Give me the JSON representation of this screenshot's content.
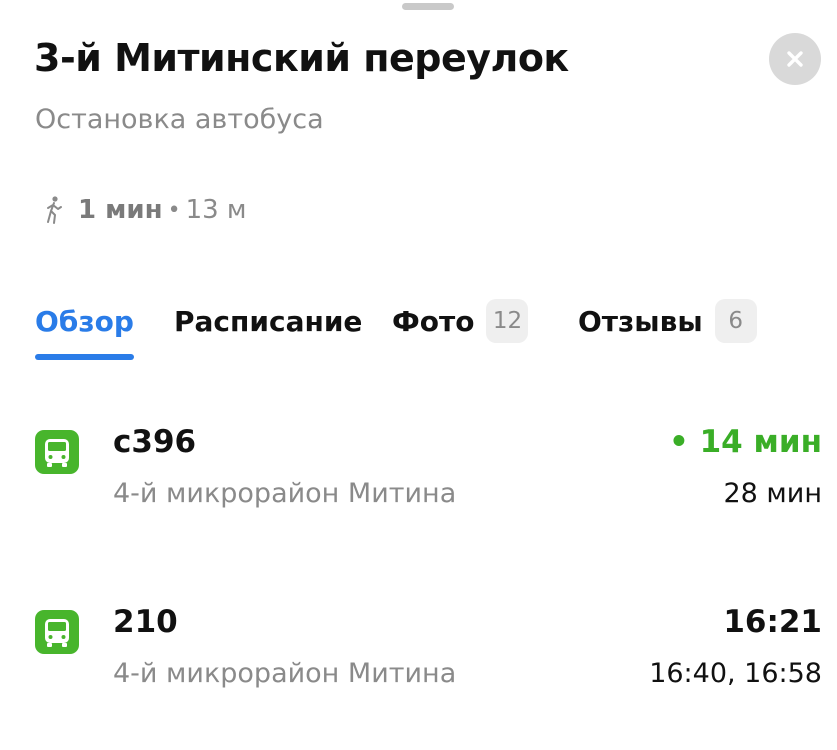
{
  "header": {
    "title": "3-й Митинский переулок",
    "subtitle": "Остановка автобуса",
    "close_icon": "close-icon"
  },
  "walk": {
    "icon": "walking-person-icon",
    "time": "1 мин",
    "separator": "•",
    "distance": "13 м"
  },
  "tabs": [
    {
      "label": "Обзор",
      "active": true
    },
    {
      "label": "Расписание"
    },
    {
      "label": "Фото",
      "badge": "12"
    },
    {
      "label": "Отзывы",
      "badge": "6"
    }
  ],
  "routes": [
    {
      "icon": "bus-icon",
      "number": "с396",
      "destination": "4-й микрорайон Митина",
      "arrival": "• 14 мин",
      "arrival_live": true,
      "next": "28 мин"
    },
    {
      "icon": "bus-icon",
      "number": "210",
      "destination": "4-й микрорайон Митина",
      "arrival": "16:21",
      "arrival_live": false,
      "next": "16:40, 16:58"
    }
  ],
  "colors": {
    "accent": "#2a7ce8",
    "bus_icon": "#48b52c",
    "live_arrival": "#3aae27",
    "secondary_text": "#8a8a8a"
  }
}
